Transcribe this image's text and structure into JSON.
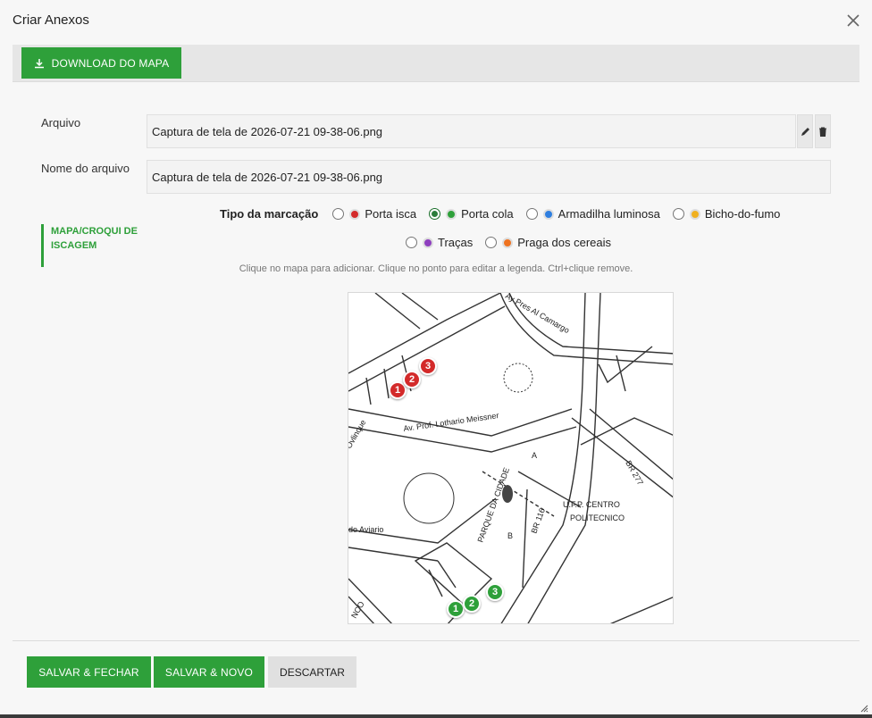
{
  "dialog": {
    "title": "Criar Anexos",
    "close_icon": "close-icon"
  },
  "toolbar": {
    "download_label": "DOWNLOAD DO MAPA",
    "download_icon": "download-icon"
  },
  "form": {
    "file_label": "Arquivo",
    "file_value": "Captura de tela de 2026-07-21 09-38-06.png",
    "edit_icon": "pencil-icon",
    "delete_icon": "trash-icon",
    "name_label": "Nome do arquivo",
    "name_value": "Captura de tela de 2026-07-21 09-38-06.png"
  },
  "side_tab": {
    "label": "MAPA/CROQUI DE ISCAGEM"
  },
  "marking": {
    "label": "Tipo da marcação",
    "options": [
      {
        "label": "Porta isca",
        "color": "#d32a2a",
        "selected": false
      },
      {
        "label": "Porta cola",
        "color": "#2ea03a",
        "selected": true
      },
      {
        "label": "Armadilha luminosa",
        "color": "#2f7fe0",
        "selected": false
      },
      {
        "label": "Bicho-do-fumo",
        "color": "#f0b020",
        "selected": false
      },
      {
        "label": "Traças",
        "color": "#8e3fbf",
        "selected": false
      },
      {
        "label": "Praga dos cereais",
        "color": "#ef7320",
        "selected": false
      }
    ],
    "hint": "Clique no mapa para adicionar. Clique no ponto para editar a legenda. Ctrl+clique remove."
  },
  "map": {
    "street_labels": [
      "Av. Prof. Lothario Meissner",
      "U.F.P. CENTRO",
      "POLITECNICO",
      "PARQUE DA CIDADE",
      "BR 116",
      "BR 277",
      "Ay Pres Al Camargo",
      "do Aviario",
      "A",
      "B",
      "Ovlinque",
      "NCO"
    ],
    "markers_red": [
      "1",
      "2",
      "3"
    ],
    "markers_green": [
      "1",
      "2",
      "3"
    ]
  },
  "footer": {
    "save_close": "SALVAR & FECHAR",
    "save_new": "SALVAR & NOVO",
    "discard": "DESCARTAR"
  }
}
